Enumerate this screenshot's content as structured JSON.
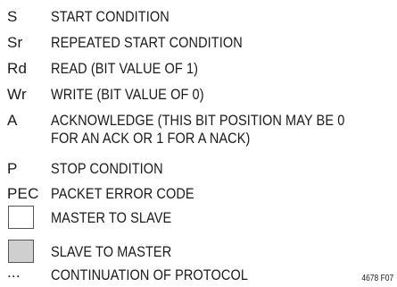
{
  "legend": {
    "items": [
      {
        "symbol": "S",
        "description": "START CONDITION"
      },
      {
        "symbol": "Sr",
        "description": "REPEATED START CONDITION"
      },
      {
        "symbol": "Rd",
        "description": "READ (BIT VALUE OF 1)"
      },
      {
        "symbol": "Wr",
        "description": "WRITE (BIT VALUE OF 0)"
      },
      {
        "symbol": "A",
        "description_line1": "ACKNOWLEDGE (THIS BIT POSITION MAY BE 0",
        "description_line2": "FOR AN ACK OR 1 FOR A NACK)"
      },
      {
        "symbol": "P",
        "description": "STOP CONDITION"
      },
      {
        "symbol": "PEC",
        "description": "PACKET ERROR CODE"
      },
      {
        "symbol_box_color": "#ffffff",
        "description": "MASTER TO SLAVE"
      },
      {
        "symbol_box_color": "#cfcfcf",
        "description": "SLAVE TO MASTER"
      },
      {
        "symbol": "...",
        "description": "CONTINUATION OF PROTOCOL"
      }
    ],
    "figure_number": "4678 F07"
  }
}
